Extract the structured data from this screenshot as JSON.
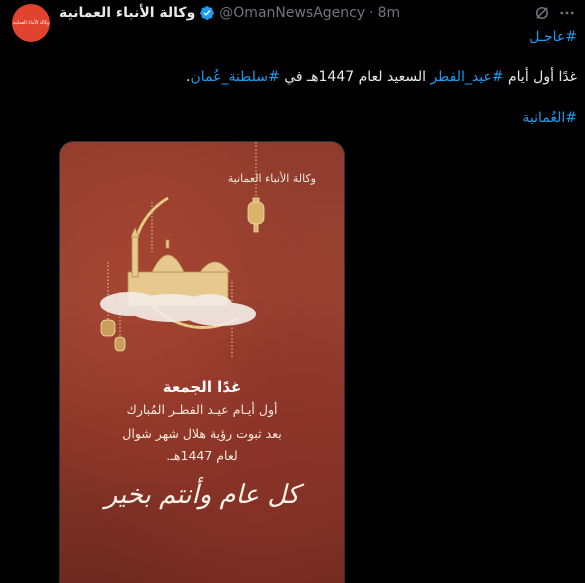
{
  "author": {
    "display_name": "وكالة الأنباء العمانية",
    "handle": "@OmanNewsAgency",
    "separator": "·",
    "time": "8m",
    "avatar_text": "وكالة الأنباء العمانية",
    "verified_color": "#1d9bf0"
  },
  "icons": {
    "grok": "grok-icon",
    "more": "more-icon",
    "verified": "verified-badge-icon"
  },
  "tweet": {
    "breaking_tag": "#عاجـل",
    "line1": {
      "p1": "غدًا أول أيام ",
      "tag1": "#عيد_الفطر",
      "p2": " السعيد لعام 1447هـ في ",
      "tag2": "#سلطنة_عُمان",
      "p3": "."
    },
    "line2_tag": "#العُمانية"
  },
  "image": {
    "wordmark": "وكالة الأنباء العمانية",
    "title": "غدًا الجمعة",
    "line1": "أول أيـام عيـد الفطـر المُبارك",
    "line2": "بعد ثبوت رؤية هلال شهر شوال",
    "line3": "لعام 1447هـ.",
    "calligraphy": "كل عام وأنتم بخير"
  },
  "colors": {
    "background": "#000000",
    "text": "#e7e9ea",
    "secondary": "#71767b",
    "link": "#1d9bf0",
    "avatar_bg": "#e2432f",
    "image_bg": "#8f3b2d",
    "gold": "#d9b36a"
  }
}
